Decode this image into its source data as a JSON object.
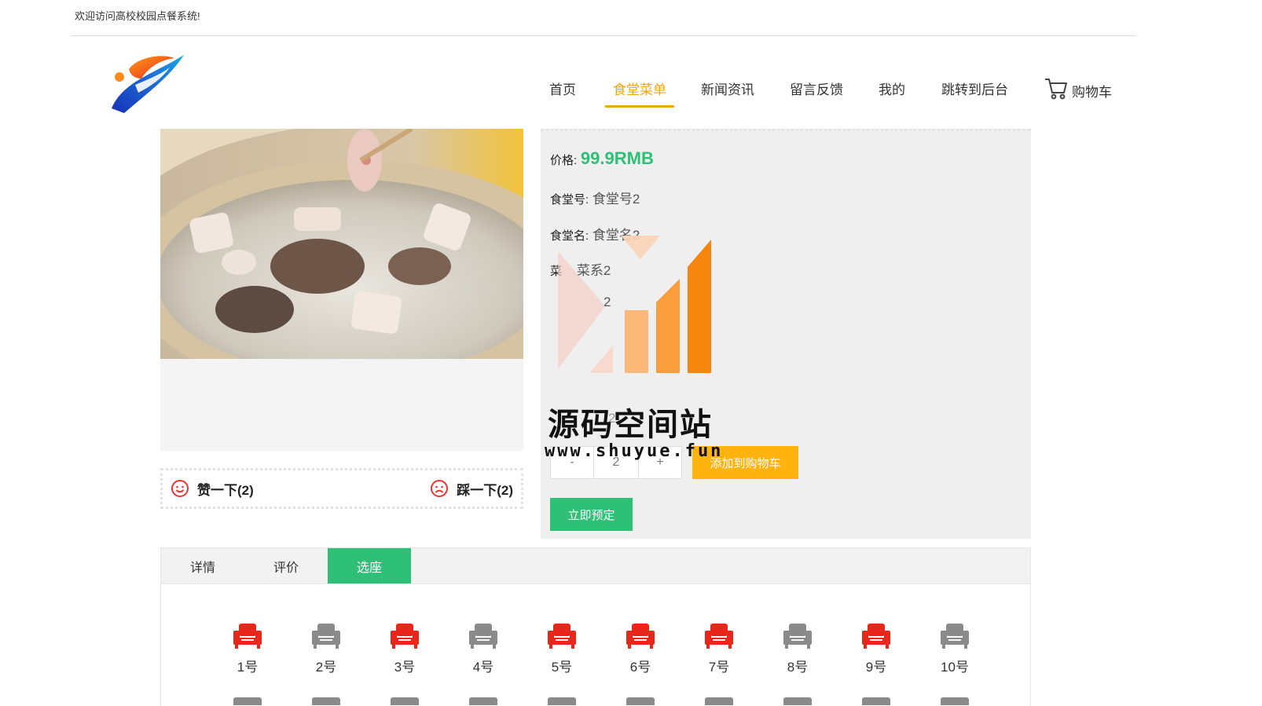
{
  "header": {
    "welcome": "欢迎访问高校校园点餐系统!"
  },
  "nav": {
    "items": [
      {
        "label": "首页",
        "left": 0
      },
      {
        "label": "食堂菜单",
        "active": true
      },
      {
        "label": "新闻资讯"
      },
      {
        "label": "留言反馈"
      },
      {
        "label": "我的"
      },
      {
        "label": "跳转到后台"
      }
    ],
    "cart": "购物车"
  },
  "product": {
    "price_label": "价格:",
    "price": "99.9RMB",
    "rows": [
      {
        "key": "食堂号:",
        "value": "食堂号2"
      },
      {
        "key": "食堂名:",
        "value": "食堂名2"
      },
      {
        "key": "菜",
        "value": "菜系2"
      },
      {
        "key": "",
        "value": "2"
      }
    ],
    "partial_row": "2",
    "quantity": "2",
    "minus": "-",
    "plus": "+",
    "add_to_cart": "添加到购物车",
    "book_now": "立即预定"
  },
  "votes": {
    "like": "赞一下(2)",
    "dislike": "踩一下(2)"
  },
  "watermark": {
    "title": "源码空间站",
    "url": "www.shuyue.fun"
  },
  "tabs": [
    {
      "label": "详情"
    },
    {
      "label": "评价"
    },
    {
      "label": "选座",
      "active": true
    }
  ],
  "seats": [
    {
      "label": "1号",
      "status": "taken"
    },
    {
      "label": "2号",
      "status": "free"
    },
    {
      "label": "3号",
      "status": "taken"
    },
    {
      "label": "4号",
      "status": "free"
    },
    {
      "label": "5号",
      "status": "taken"
    },
    {
      "label": "6号",
      "status": "taken"
    },
    {
      "label": "7号",
      "status": "taken"
    },
    {
      "label": "8号",
      "status": "free"
    },
    {
      "label": "9号",
      "status": "taken"
    },
    {
      "label": "10号",
      "status": "free"
    }
  ],
  "colors": {
    "accent_orange": "#f4a50b",
    "green": "#2dc076",
    "seat_taken": "#e8271a",
    "seat_free": "#8a8a8a"
  }
}
